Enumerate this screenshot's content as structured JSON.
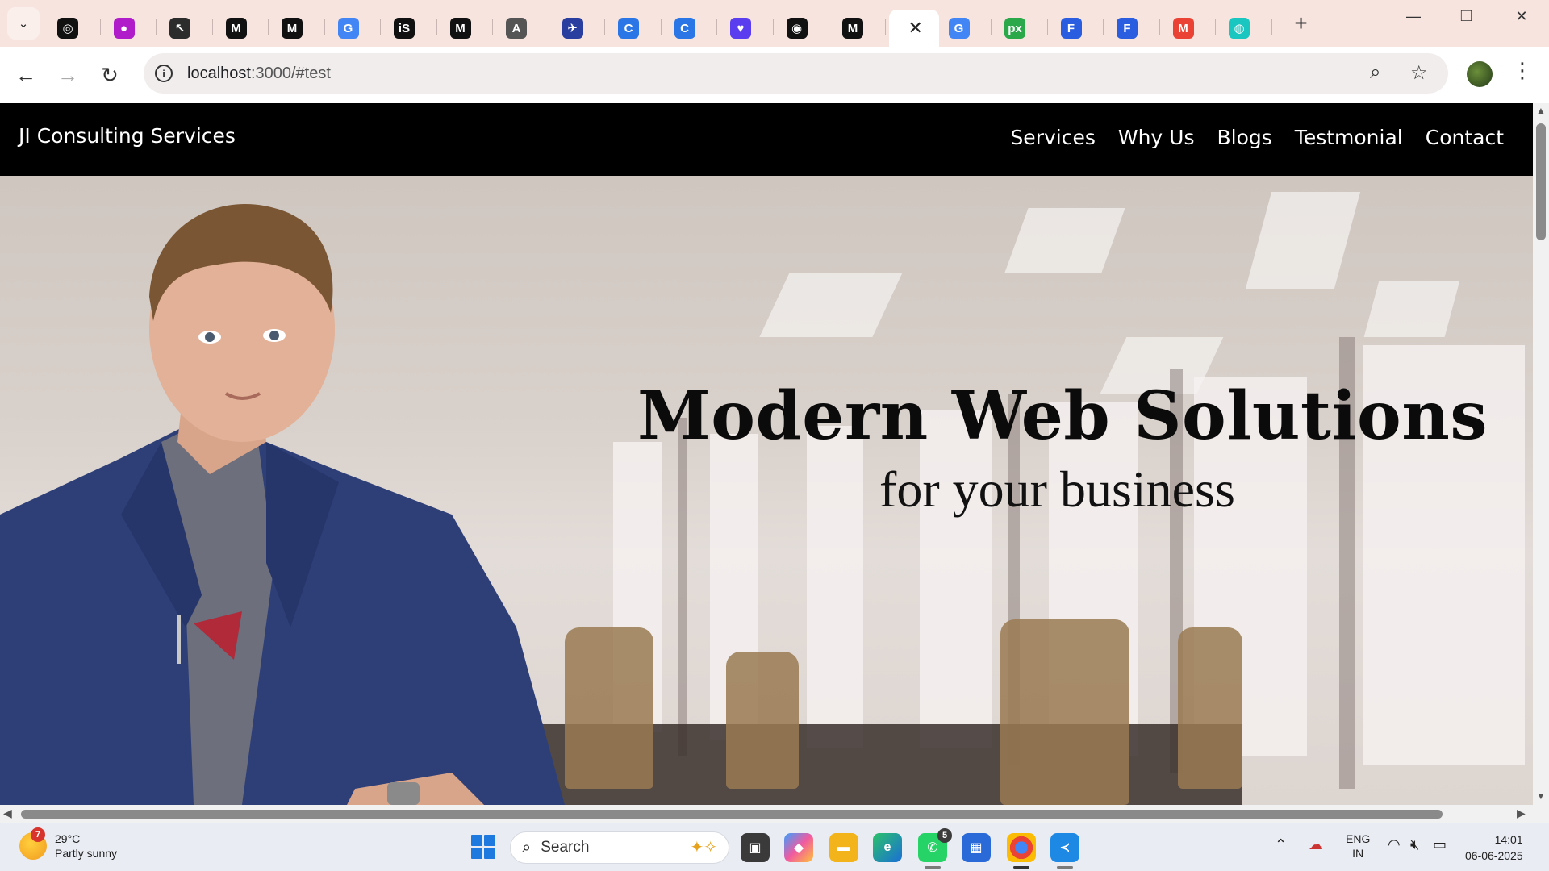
{
  "browser": {
    "tabs": [
      {
        "icon": "openai-icon",
        "glyph": "◎",
        "bg": "#111111"
      },
      {
        "icon": "purple-orb-icon",
        "glyph": "●",
        "bg": "#b01cc9"
      },
      {
        "icon": "cursor-app-icon",
        "glyph": "↖",
        "bg": "#2c2c2c"
      },
      {
        "icon": "medium-icon",
        "glyph": "M",
        "bg": "#111111"
      },
      {
        "icon": "medium-alt-icon",
        "glyph": "M",
        "bg": "#111111"
      },
      {
        "icon": "google-icon",
        "glyph": "G",
        "bg": "#4285f4"
      },
      {
        "icon": "is-icon",
        "glyph": "iS",
        "bg": "#111111"
      },
      {
        "icon": "medium-icon-2",
        "glyph": "M",
        "bg": "#111111"
      },
      {
        "icon": "a-icon",
        "glyph": "A",
        "bg": "#555555"
      },
      {
        "icon": "plane-icon",
        "glyph": "✈",
        "bg": "#2a3ea0"
      },
      {
        "icon": "c-blue-icon",
        "glyph": "C",
        "bg": "#2a76e6"
      },
      {
        "icon": "c-blue-icon-2",
        "glyph": "C",
        "bg": "#2a76e6"
      },
      {
        "icon": "heart-chat-icon",
        "glyph": "♥",
        "bg": "#5b3df0"
      },
      {
        "icon": "github-icon",
        "glyph": "◉",
        "bg": "#111111"
      },
      {
        "icon": "medium-icon-3",
        "glyph": "M",
        "bg": "#111111"
      }
    ],
    "tabs_after": [
      {
        "icon": "google-icon-2",
        "glyph": "G",
        "bg": "#4285f4"
      },
      {
        "icon": "px-icon",
        "glyph": "px",
        "bg": "#2aa84a"
      },
      {
        "icon": "forms-icon",
        "glyph": "F",
        "bg": "#2a5de0"
      },
      {
        "icon": "forms-icon-2",
        "glyph": "F",
        "bg": "#2a5de0"
      },
      {
        "icon": "gmail-icon",
        "glyph": "M",
        "bg": "#ea4335"
      },
      {
        "icon": "fingerprint-icon",
        "glyph": "◍",
        "bg": "#19c7c0"
      }
    ],
    "active_tab_close": "✕",
    "url_host": "localhost",
    "url_path": ":3000/#test"
  },
  "site": {
    "brand": "JI Consulting Services",
    "nav": [
      "Services",
      "Why Us",
      "Blogs",
      "Testmonial",
      "Contact"
    ],
    "hero_title": "Modern Web Solutions",
    "hero_subtitle": "for your business"
  },
  "taskbar": {
    "weather_temp": "29°C",
    "weather_desc": "Partly sunny",
    "weather_badge": "7",
    "search_label": "Search",
    "whatsapp_badge": "5",
    "lang": "ENG",
    "region": "IN",
    "time": "14:01",
    "date": "06-06-2025"
  }
}
